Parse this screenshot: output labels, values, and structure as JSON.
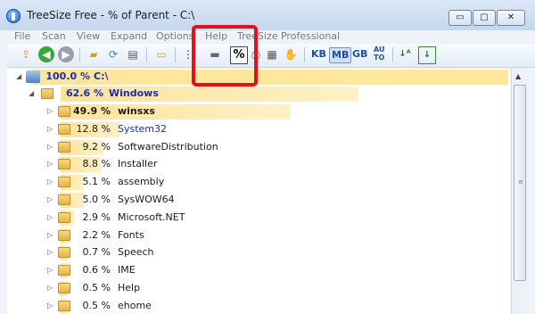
{
  "window": {
    "title": "TreeSize Free - % of Parent - C:\\",
    "min_label": "▭",
    "max_label": "▢",
    "close_label": "✕"
  },
  "menu": [
    "File",
    "Scan",
    "View",
    "Expand",
    "Options",
    "Help",
    "TreeSize Professional"
  ],
  "toolbar": {
    "percent_label": "%",
    "kb_label": "KB",
    "mb_label": "MB",
    "gb_label": "GB",
    "auto_top": "AU",
    "auto_bottom": "TO",
    "sort_alpha_icon": "sort-alpha-icon",
    "sort_size_icon": "sort-size-icon"
  },
  "tree": {
    "root": {
      "percent": "100.0 %",
      "name": "C:\\"
    },
    "windows": {
      "percent": "62.6 %",
      "name": "Windows"
    },
    "children": [
      {
        "percent": "49.9 %",
        "name": "winsxs",
        "fill": 0.499
      },
      {
        "percent": "12.8 %",
        "name": "System32",
        "fill": 0.128
      },
      {
        "percent": "9.2 %",
        "name": "SoftwareDistribution",
        "fill": 0.092
      },
      {
        "percent": "8.8 %",
        "name": "Installer",
        "fill": 0.088
      },
      {
        "percent": "5.1 %",
        "name": "assembly",
        "fill": 0.051
      },
      {
        "percent": "5.0 %",
        "name": "SysWOW64",
        "fill": 0.05
      },
      {
        "percent": "2.9 %",
        "name": "Microsoft.NET",
        "fill": 0.029
      },
      {
        "percent": "2.2 %",
        "name": "Fonts",
        "fill": 0.022
      },
      {
        "percent": "0.7 %",
        "name": "Speech",
        "fill": 0.007
      },
      {
        "percent": "0.6 %",
        "name": "IME",
        "fill": 0.006
      },
      {
        "percent": "0.5 %",
        "name": "Help",
        "fill": 0.005
      },
      {
        "percent": "0.5 %",
        "name": "ehome",
        "fill": 0.005
      }
    ]
  },
  "colors": {
    "accent": "#1a2fa3",
    "bar": "#fde39a",
    "highlight": "#e3101e"
  }
}
